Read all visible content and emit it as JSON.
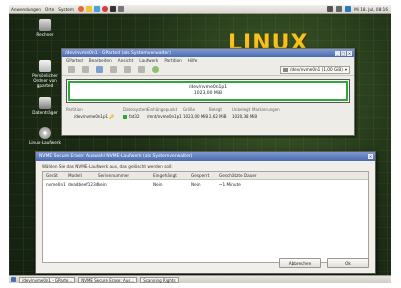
{
  "top_panel": {
    "menus": [
      "Anwendungen",
      "Orte",
      "System"
    ],
    "clock": "Mi 18. Jul, 08:16"
  },
  "desktop": {
    "logo_text": "LINUX",
    "icons": [
      {
        "label": "Rechner"
      },
      {
        "label": "Persönlicher Ordner von gparted"
      },
      {
        "label": "Datenträger"
      },
      {
        "label": "Linux-Laufwerk"
      }
    ]
  },
  "gparted": {
    "title": "/dev/nvme0n1 - GParted (als Systemverwalter)",
    "menu": [
      "GParted",
      "Bearbeiten",
      "Ansicht",
      "Laufwerk",
      "Partition",
      "Hilfe"
    ],
    "device_selector": "/dev/nvme0n1 (1,00 GiB)",
    "partition_visual": {
      "name": "/dev/nvme0n1p1",
      "size": "1023,00 MiB"
    },
    "table": {
      "headers": [
        "Partition",
        "Dateisystem",
        "Einhängepunkt",
        "Größe",
        "Belegt",
        "Unbelegt",
        "Markierungen"
      ],
      "rows": [
        {
          "partition": "/dev/nvme0n1p1 🔑",
          "filesystem": "fat32",
          "mountpoint": "/mnt/nvme0n1p1",
          "size": "1023,00 MiB",
          "used": "2,62 MiB",
          "unused": "1020,38 MiB",
          "flags": ""
        }
      ]
    }
  },
  "nvme_dialog": {
    "title": "NVME Secure Erase: Auswahl NVME-Laufwerk (als Systemverwalter)",
    "instruction": "Wählen Sie das NVME-Laufwerk aus, das gelöscht werden soll:",
    "headers": [
      "Gerät",
      "Modell",
      "Seriennummer",
      "Eingehängt",
      "Gesperrt",
      "Geschätzte Dauer"
    ],
    "rows": [
      {
        "device": "nvme0n1",
        "model": "deadbeef1234",
        "serial": "kein",
        "mounted": "Nein",
        "locked": "Nein",
        "duration": "~1 Minute"
      }
    ],
    "buttons": {
      "cancel": "Abbrechen",
      "ok": "Ok"
    }
  },
  "taskbar": {
    "items": [
      "/dev/nvme0n1 - GParte...",
      "NVME Secure Erase: Aus...",
      "Scanning Rights"
    ]
  },
  "colors": {
    "titlebar": "#5a78bd",
    "partition_green": "#2fa83a",
    "logo_yellow": "#f6c21b"
  }
}
